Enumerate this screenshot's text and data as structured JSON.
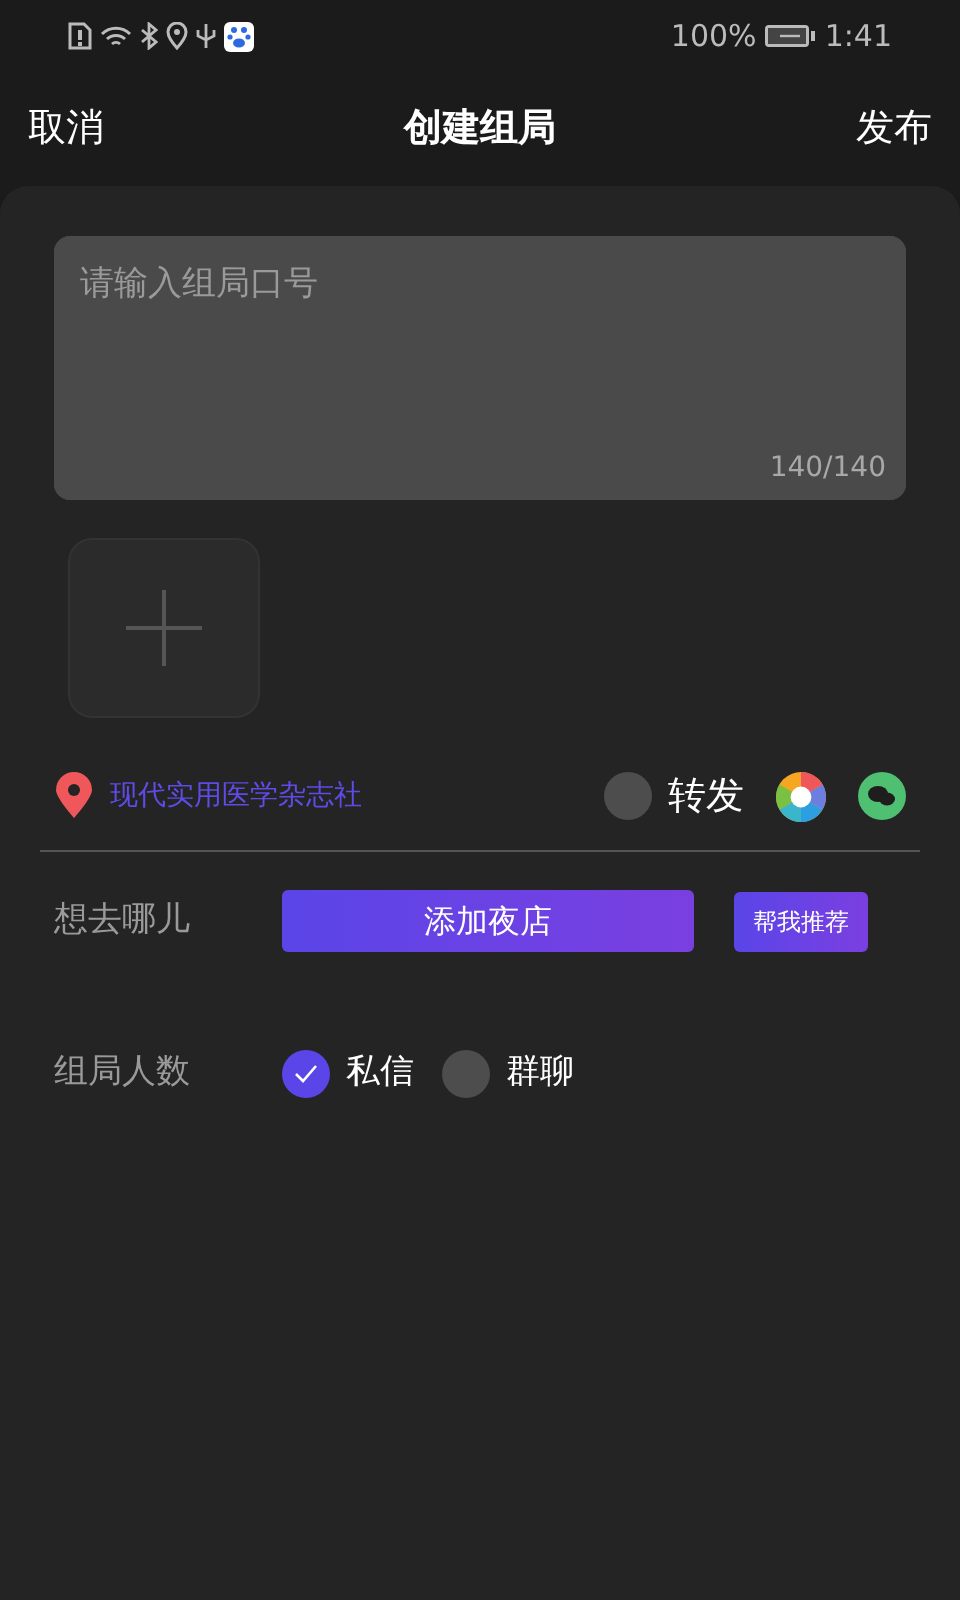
{
  "status_bar": {
    "battery_text": "100%",
    "time": "1:41"
  },
  "header": {
    "cancel": "取消",
    "title": "创建组局",
    "publish": "发布"
  },
  "slogan": {
    "placeholder": "请输入组局口号",
    "counter": "140/140"
  },
  "location": {
    "name": "现代实用医学杂志社"
  },
  "forward": {
    "label": "转发",
    "checked": false
  },
  "destination": {
    "label": "想去哪儿",
    "add_button": "添加夜店",
    "recommend_button": "帮我推荐"
  },
  "group_size": {
    "label": "组局人数",
    "options": [
      {
        "label": "私信",
        "selected": true
      },
      {
        "label": "群聊",
        "selected": false
      }
    ]
  }
}
